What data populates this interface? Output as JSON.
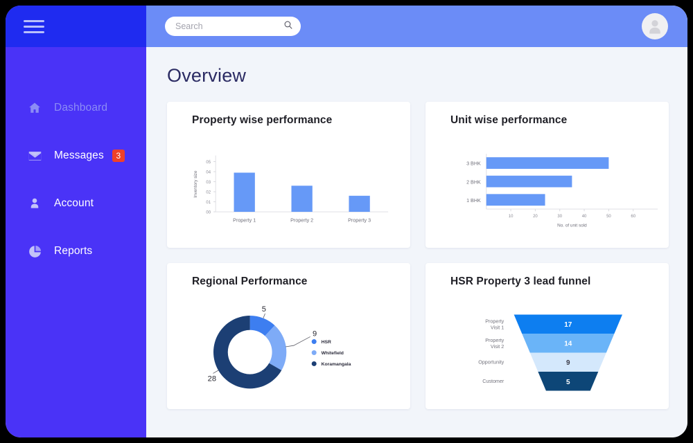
{
  "app": {
    "page_title": "Overview"
  },
  "sidebar": {
    "menu_icon": "hamburger-icon",
    "items": [
      {
        "label": "Dashboard",
        "icon": "home-icon",
        "muted": true,
        "badge": ""
      },
      {
        "label": "Messages",
        "icon": "envelope-icon",
        "muted": false,
        "badge": "3"
      },
      {
        "label": "Account",
        "icon": "person-icon",
        "muted": false,
        "badge": ""
      },
      {
        "label": "Reports",
        "icon": "pie-chart-icon",
        "muted": false,
        "badge": ""
      }
    ],
    "badge_color": "#ef4129",
    "background": "#4a33f7",
    "logo_background": "#1f2bf0"
  },
  "topbar": {
    "background": "#6b8cf7",
    "search": {
      "placeholder": "Search",
      "value": "",
      "icon": "search-icon"
    },
    "avatar_icon": "user-avatar-icon"
  },
  "cards": [
    {
      "title": "Property wise performance"
    },
    {
      "title": "Unit wise performance"
    },
    {
      "title": "Regional Performance"
    },
    {
      "title": "HSR Property 3 lead funnel"
    }
  ],
  "chart_data": [
    {
      "type": "bar",
      "title": "Property wise performance",
      "categories": [
        "Property 1",
        "Property 2",
        "Property 3"
      ],
      "values": [
        0.39,
        0.26,
        0.16
      ],
      "xlabel": "",
      "ylabel": "Inventory size",
      "ylim": [
        0.0,
        0.55
      ],
      "yticks": [
        0.0,
        0.1,
        0.2,
        0.3,
        0.4,
        0.5
      ],
      "ytick_labels": [
        "00",
        "01",
        "02",
        "03",
        "04",
        "05"
      ],
      "grid": false,
      "bar_color": "#6699f7",
      "orientation": "vertical"
    },
    {
      "type": "bar",
      "title": "Unit wise performance",
      "categories": [
        "3 BHK",
        "2 BHK",
        "1 BHK"
      ],
      "values": [
        50,
        35,
        24
      ],
      "xlabel": "No. of unit sold",
      "ylabel": "",
      "xlim": [
        0,
        70
      ],
      "xticks": [
        10,
        20,
        30,
        40,
        50,
        60
      ],
      "xtick_labels": [
        "10",
        "20",
        "30",
        "40",
        "50",
        "60"
      ],
      "grid": false,
      "bar_color": "#6699f7",
      "orientation": "horizontal"
    },
    {
      "type": "pie",
      "variant": "donut",
      "title": "Regional Performance",
      "labels": [
        "HSR",
        "Whitefield",
        "Koramangala"
      ],
      "values": [
        5,
        9,
        28
      ],
      "total": 42,
      "colors": [
        "#3d7ef0",
        "#7eabf7",
        "#1c3f74"
      ],
      "data_labels": [
        "5",
        "9",
        "28"
      ],
      "legend": [
        "HSR",
        "Whitefield",
        "Koramangala"
      ],
      "legend_position": "right"
    },
    {
      "type": "bar",
      "variant": "funnel",
      "title": "HSR Property 3 lead funnel",
      "categories": [
        "Property Visit 1",
        "Property Visit 2",
        "Opportunity",
        "Customer"
      ],
      "category_lines": [
        [
          "Property",
          "Visit 1"
        ],
        [
          "Property",
          "Visit 2"
        ],
        [
          "Opportunity"
        ],
        [
          "Customer"
        ]
      ],
      "values": [
        17,
        14,
        9,
        5
      ],
      "colors": [
        "#0d7ef0",
        "#6ab4f8",
        "#d4e8fc",
        "#0d4677"
      ],
      "value_text_colors": [
        "#ffffff",
        "#ffffff",
        "#3a3a46",
        "#ffffff"
      ]
    }
  ]
}
